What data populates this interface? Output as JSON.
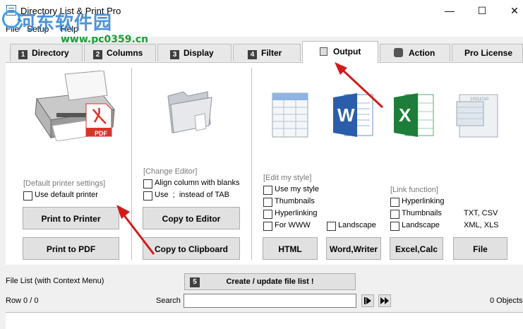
{
  "window": {
    "title": "Directory List & Print Pro",
    "minimize": "—",
    "maximize": "☐",
    "close": "✕"
  },
  "watermark": {
    "text": "河东软件园",
    "url": "www.pc0359.cn"
  },
  "menu": {
    "file": "File",
    "setup": "Setup",
    "help": "Help"
  },
  "tabs": [
    {
      "num": "1",
      "label": "Directory"
    },
    {
      "num": "2",
      "label": "Columns"
    },
    {
      "num": "3",
      "label": "Display"
    },
    {
      "num": "4",
      "label": "Filter"
    },
    {
      "label": "Output",
      "icon": "document-icon"
    },
    {
      "label": "Action",
      "icon": "gear-icon"
    },
    {
      "label": "Pro License"
    }
  ],
  "printer": {
    "section_label": "[Default printer settings]",
    "use_default": "Use default printer",
    "print_button": "Print to Printer",
    "pdf_button": "Print to PDF",
    "pdf_badge": "PDF"
  },
  "editor": {
    "section_label": "[Change Editor]",
    "align_blanks": "Align column with blanks",
    "use_semicolon": "Use  ;  instead of TAB",
    "copy_editor": "Copy to Editor",
    "copy_clipboard": "Copy to Clipboard"
  },
  "styles": {
    "section_label": "[Edit my style]",
    "use_my_style": "Use my style",
    "thumbnails": "Thumbnails",
    "hyperlinking": "Hyperlinking",
    "for_www": "For WWW",
    "landscape": "Landscape",
    "html_button": "HTML",
    "word_button": "Word,Writer"
  },
  "link": {
    "section_label": "[Link function]",
    "hyperlinking": "Hyperlinking",
    "thumbnails": "Thumbnails",
    "landscape": "Landscape",
    "excel_button": "Excel,Calc",
    "file_button": "File",
    "txt_csv": "TXT, CSV",
    "xml_xls": "XML, XLS",
    "binary_text": "10011010"
  },
  "bottom": {
    "file_list_label": "File List (with Context Menu)",
    "step_num": "5",
    "create_button": "Create / update file list !",
    "row_label": "Row 0 / 0",
    "search_label": "Search",
    "objects_label": "0 Objects"
  },
  "colors": {
    "arrow": "#d21a1a",
    "pdf_red": "#d9342b",
    "word_blue": "#2a5daa",
    "excel_green": "#1e7d3a"
  }
}
